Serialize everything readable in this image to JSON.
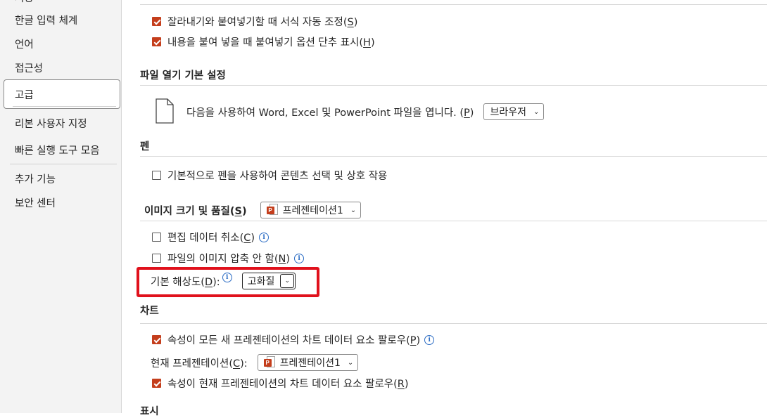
{
  "sidebar": {
    "cut_item": "저장",
    "items": [
      {
        "label": "한글 입력 체계"
      },
      {
        "label": "언어"
      },
      {
        "label": "접근성"
      },
      {
        "label": "고급",
        "selected": true
      },
      {
        "label": "리본 사용자 지정"
      },
      {
        "label": "빠른 실행 도구 모음"
      },
      {
        "label": "추가 기능"
      },
      {
        "label": "보안 센터"
      }
    ]
  },
  "cut_paste": {
    "smart_cut": {
      "label": "잘라내기와 붙여넣기할 때 서식 자동 조정(",
      "key": "S",
      "tail": ")",
      "checked": true
    },
    "show_paste_options": {
      "label": "내용을 붙여 넣을 때 붙여넣기 옵션 단추 표시(",
      "key": "H",
      "tail": ")",
      "checked": true
    }
  },
  "file_open": {
    "section_title": "파일 열기 기본 설정",
    "label": "다음을 사용하여 Word, Excel 및 PowerPoint 파일을 엽니다. (",
    "key": "P",
    "tail": ")",
    "dropdown_value": "브라우저"
  },
  "pen": {
    "section_title": "펜",
    "use_pen": {
      "label": "기본적으로 펜을 사용하여 콘텐츠 선택 및 상호 작용",
      "checked": false
    }
  },
  "image": {
    "section_title": "이미지 크기 및 품질(",
    "key": "S",
    "tail": ")",
    "dropdown_value": "프레젠테이션1",
    "discard_edit": {
      "label": "편집 데이터 취소(",
      "key": "C",
      "tail": ")",
      "checked": false
    },
    "no_compress": {
      "label": "파일의 이미지 압축 안 함(",
      "key": "N",
      "tail": ")",
      "checked": false
    },
    "default_resolution": {
      "label": "기본 해상도(",
      "key": "D",
      "tail": "):",
      "value": "고화질"
    }
  },
  "chart": {
    "section_title": "차트",
    "follow_all": {
      "label": "속성이 모든 새 프레젠테이션의 차트 데이터 요소 팔로우(",
      "key": "P",
      "tail": ")",
      "checked": true
    },
    "current_label": "현재 프레젠테이션(",
    "current_key": "C",
    "current_tail": "):",
    "current_value": "프레젠테이션1",
    "follow_current": {
      "label": "속성이 현재 프레젠테이션의 차트 데이터 요소 팔로우(",
      "key": "R",
      "tail": ")",
      "checked": true
    }
  },
  "next_section": "표시",
  "icons": {
    "info": "i",
    "ppt_badge": "P",
    "chevron": "⌄"
  },
  "colors": {
    "accent": "#c43e1c",
    "highlight": "#e0111c",
    "info": "#2b6cc4"
  }
}
